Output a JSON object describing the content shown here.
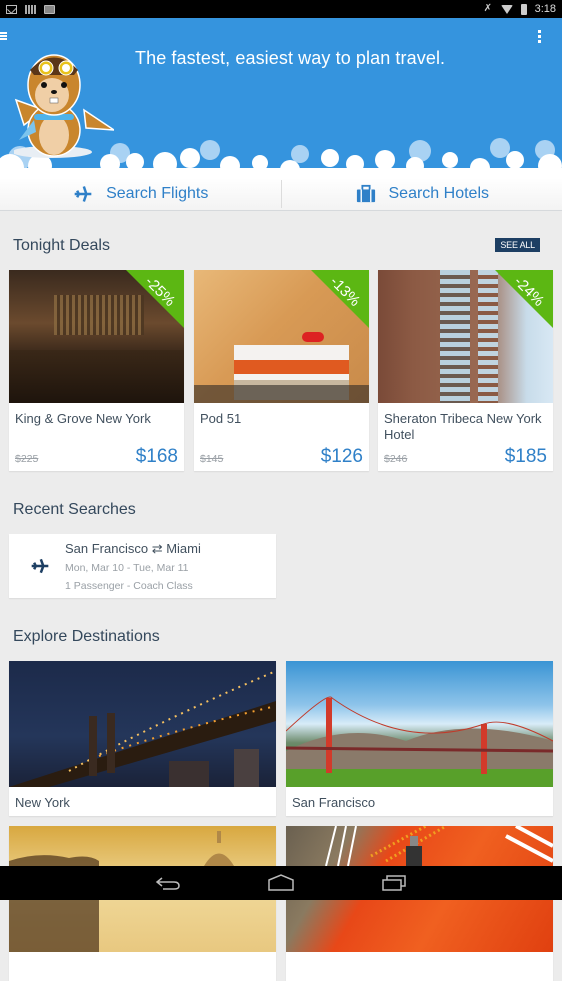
{
  "status_bar": {
    "left_icons": [
      "gmail-icon",
      "barcode-icon",
      "shopping-bag-icon"
    ],
    "right_icons": [
      "mute-icon",
      "wifi-icon",
      "battery-icon"
    ],
    "time": "3:18"
  },
  "hero": {
    "tagline": "The fastest, easiest way to plan travel.",
    "menu_icon": "menu-icon",
    "overflow_icon": "overflow-menu-icon",
    "mascot": "chipmunk-aviator-mascot",
    "background_color": "#3594de"
  },
  "search": {
    "flights_label": "Search Flights",
    "hotels_label": "Search Hotels",
    "accent_color": "#2f80c8"
  },
  "tonight_deals": {
    "title": "Tonight Deals",
    "see_all_label": "SEE ALL",
    "deals": [
      {
        "name": "King & Grove New York",
        "discount": "-25%",
        "original_price": "$225",
        "price": "$168",
        "image": "hotel-bar-lounge"
      },
      {
        "name": "Pod 51",
        "discount": "-13%",
        "original_price": "$145",
        "price": "$126",
        "image": "hotel-bedroom"
      },
      {
        "name": "Sheraton Tribeca New York Hotel",
        "discount": "-24%",
        "original_price": "$246",
        "price": "$185",
        "image": "hotel-building-exterior"
      }
    ],
    "ribbon_color": "#5cb713"
  },
  "recent_searches": {
    "title": "Recent Searches",
    "items": [
      {
        "route": "San Francisco ⇄ Miami",
        "dates": "Mon, Mar 10 - Tue, Mar 11",
        "details": "1 Passenger - Coach Class",
        "icon": "plane-icon"
      }
    ]
  },
  "explore": {
    "title": "Explore Destinations",
    "destinations": [
      {
        "name": "New York",
        "image": "manhattan-bridge-night"
      },
      {
        "name": "San Francisco",
        "image": "golden-gate-bridge"
      },
      {
        "name": "",
        "image": "rome-st-peters-dome"
      },
      {
        "name": "",
        "image": "japanese-temple-red"
      }
    ]
  },
  "nav_bar": {
    "buttons": [
      "back",
      "home",
      "recent-apps"
    ]
  }
}
